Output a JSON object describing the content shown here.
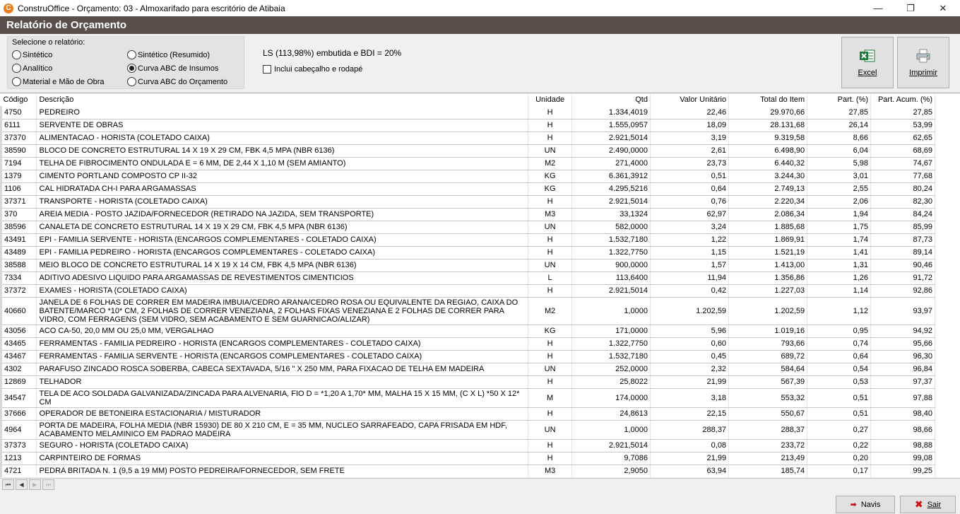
{
  "window": {
    "title": "ConstruOffice - Orçamento: 03 - Almoxarifado para escritório de Atibaia",
    "icon": "construoffice-app-icon",
    "min_glyph": "—",
    "max_glyph": "❐",
    "close_glyph": "✕"
  },
  "header": {
    "title": "Relatório de Orçamento"
  },
  "options": {
    "group_label": "Selecione o relatório:",
    "radios": [
      {
        "label": "Sintético",
        "selected": false
      },
      {
        "label": "Analítico",
        "selected": false
      },
      {
        "label": "Material e Mão de Obra",
        "selected": false
      },
      {
        "label": "Sintético (Resumido)",
        "selected": false
      },
      {
        "label": "Curva ABC de Insumos",
        "selected": true
      },
      {
        "label": "Curva ABC do Orçamento",
        "selected": false
      }
    ],
    "ls_text": "LS (113,98%) embutida e BDI = 20%",
    "include_header_label": "Inclui cabeçalho e rodapé",
    "include_header_checked": false,
    "excel_label": "Excel",
    "print_label": "Imprimir"
  },
  "table": {
    "columns": [
      "Código",
      "Descrição",
      "Unidade",
      "Qtd",
      "Valor Unitário",
      "Total do Item",
      "Part. (%)",
      "Part. Acum. (%)"
    ],
    "rows": [
      [
        "4750",
        "PEDREIRO",
        "H",
        "1.334,4019",
        "22,46",
        "29.970,66",
        "27,85",
        "27,85"
      ],
      [
        "6111",
        "SERVENTE DE OBRAS",
        "H",
        "1.555,0957",
        "18,09",
        "28.131,68",
        "26,14",
        "53,99"
      ],
      [
        "37370",
        "ALIMENTACAO - HORISTA (COLETADO CAIXA)",
        "H",
        "2.921,5014",
        "3,19",
        "9.319,58",
        "8,66",
        "62,65"
      ],
      [
        "38590",
        "BLOCO DE CONCRETO ESTRUTURAL 14 X 19 X 29 CM, FBK 4,5 MPA (NBR 6136)",
        "UN",
        "2.490,0000",
        "2,61",
        "6.498,90",
        "6,04",
        "68,69"
      ],
      [
        "7194",
        "TELHA DE FIBROCIMENTO ONDULADA E = 6 MM, DE 2,44 X 1,10 M (SEM AMIANTO)",
        "M2",
        "271,4000",
        "23,73",
        "6.440,32",
        "5,98",
        "74,67"
      ],
      [
        "1379",
        "CIMENTO PORTLAND COMPOSTO CP II-32",
        "KG",
        "6.361,3912",
        "0,51",
        "3.244,30",
        "3,01",
        "77,68"
      ],
      [
        "1106",
        "CAL HIDRATADA CH-I PARA ARGAMASSAS",
        "KG",
        "4.295,5216",
        "0,64",
        "2.749,13",
        "2,55",
        "80,24"
      ],
      [
        "37371",
        "TRANSPORTE - HORISTA (COLETADO CAIXA)",
        "H",
        "2.921,5014",
        "0,76",
        "2.220,34",
        "2,06",
        "82,30"
      ],
      [
        "370",
        "AREIA MEDIA - POSTO JAZIDA/FORNECEDOR (RETIRADO NA JAZIDA, SEM TRANSPORTE)",
        "M3",
        "33,1324",
        "62,97",
        "2.086,34",
        "1,94",
        "84,24"
      ],
      [
        "38596",
        "CANALETA DE CONCRETO ESTRUTURAL 14 X 19 X 29 CM, FBK 4,5 MPA (NBR 6136)",
        "UN",
        "582,0000",
        "3,24",
        "1.885,68",
        "1,75",
        "85,99"
      ],
      [
        "43491",
        "EPI - FAMILIA SERVENTE - HORISTA (ENCARGOS COMPLEMENTARES - COLETADO CAIXA)",
        "H",
        "1.532,7180",
        "1,22",
        "1.869,91",
        "1,74",
        "87,73"
      ],
      [
        "43489",
        "EPI - FAMILIA PEDREIRO - HORISTA (ENCARGOS COMPLEMENTARES - COLETADO CAIXA)",
        "H",
        "1.322,7750",
        "1,15",
        "1.521,19",
        "1,41",
        "89,14"
      ],
      [
        "38588",
        "MEIO BLOCO DE CONCRETO ESTRUTURAL 14 X 19 X 14 CM, FBK 4,5 MPA (NBR 6136)",
        "UN",
        "900,0000",
        "1,57",
        "1.413,00",
        "1,31",
        "90,46"
      ],
      [
        "7334",
        "ADITIVO ADESIVO LIQUIDO PARA ARGAMASSAS DE REVESTIMENTOS CIMENTICIOS",
        "L",
        "113,6400",
        "11,94",
        "1.356,86",
        "1,26",
        "91,72"
      ],
      [
        "37372",
        "EXAMES - HORISTA (COLETADO CAIXA)",
        "H",
        "2.921,5014",
        "0,42",
        "1.227,03",
        "1,14",
        "92,86"
      ],
      [
        "40660",
        "JANELA DE 6 FOLHAS DE CORRER EM MADEIRA IMBUIA/CEDRO ARANA/CEDRO ROSA OU EQUIVALENTE DA REGIAO, CAIXA DO BATENTE/MARCO *10* CM, 2 FOLHAS DE CORRER VENEZIANA, 2 FOLHAS FIXAS VENEZIANA E 2 FOLHAS DE CORRER PARA VIDRO, COM FERRAGENS (SEM VIDRO, SEM ACABAMENTO E SEM GUARNICAO/ALIZAR)",
        "M2",
        "1,0000",
        "1.202,59",
        "1.202,59",
        "1,12",
        "93,97"
      ],
      [
        "43056",
        "ACO CA-50, 20,0 MM OU 25,0 MM, VERGALHAO",
        "KG",
        "171,0000",
        "5,96",
        "1.019,16",
        "0,95",
        "94,92"
      ],
      [
        "43465",
        "FERRAMENTAS - FAMILIA PEDREIRO - HORISTA (ENCARGOS COMPLEMENTARES - COLETADO CAIXA)",
        "H",
        "1.322,7750",
        "0,60",
        "793,66",
        "0,74",
        "95,66"
      ],
      [
        "43467",
        "FERRAMENTAS - FAMILIA SERVENTE - HORISTA (ENCARGOS COMPLEMENTARES - COLETADO CAIXA)",
        "H",
        "1.532,7180",
        "0,45",
        "689,72",
        "0,64",
        "96,30"
      ],
      [
        "4302",
        "PARAFUSO ZINCADO ROSCA SOBERBA, CABECA SEXTAVADA, 5/16 \" X 250 MM, PARA FIXACAO DE TELHA EM MADEIRA",
        "UN",
        "252,0000",
        "2,32",
        "584,64",
        "0,54",
        "96,84"
      ],
      [
        "12869",
        "TELHADOR",
        "H",
        "25,8022",
        "21,99",
        "567,39",
        "0,53",
        "97,37"
      ],
      [
        "34547",
        "TELA DE ACO SOLDADA GALVANIZADA/ZINCADA PARA ALVENARIA, FIO  D = *1,20 A 1,70* MM, MALHA 15 X 15 MM, (C X L) *50 X 12* CM",
        "M",
        "174,0000",
        "3,18",
        "553,32",
        "0,51",
        "97,88"
      ],
      [
        "37666",
        "OPERADOR DE BETONEIRA ESTACIONARIA / MISTURADOR",
        "H",
        "24,8613",
        "22,15",
        "550,67",
        "0,51",
        "98,40"
      ],
      [
        "4964",
        "PORTA DE MADEIRA, FOLHA MEDIA (NBR 15930) DE 80 X 210 CM, E = 35 MM, NUCLEO SARRAFEADO, CAPA FRISADA EM HDF, ACABAMENTO MELAMINICO EM PADRAO MADEIRA",
        "UN",
        "1,0000",
        "288,37",
        "288,37",
        "0,27",
        "98,66"
      ],
      [
        "37373",
        "SEGURO - HORISTA (COLETADO CAIXA)",
        "H",
        "2.921,5014",
        "0,08",
        "233,72",
        "0,22",
        "98,88"
      ],
      [
        "1213",
        "CARPINTEIRO DE FORMAS",
        "H",
        "9,7086",
        "21,99",
        "213,49",
        "0,20",
        "99,08"
      ],
      [
        "4721",
        "PEDRA BRITADA N. 1 (9,5 a 19 MM) POSTO PEDREIRA/FORNECEDOR, SEM FRETE",
        "M3",
        "2,9050",
        "63,94",
        "185,74",
        "0,17",
        "99,25"
      ]
    ]
  },
  "navigator": {
    "first": "⏮",
    "prev": "◀",
    "next": "▶",
    "last": "⏭"
  },
  "footer": {
    "navis_label": "Navis",
    "navis_icon": "➡",
    "sair_label": "Sair",
    "sair_icon": "✖"
  },
  "colors": {
    "header_band": "#5a504b",
    "app_icon": "#f07d1b",
    "excel_green": "#1d7a3a"
  }
}
